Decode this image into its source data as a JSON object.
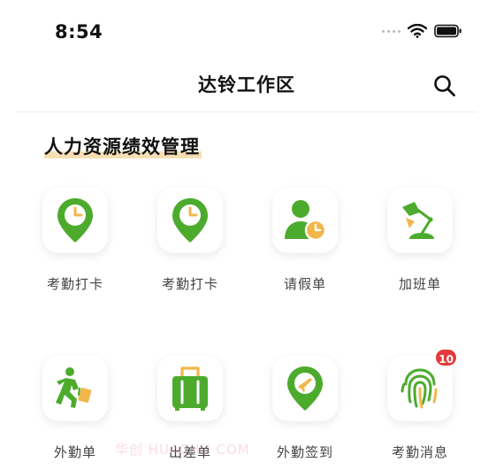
{
  "status_bar": {
    "time": "8:54"
  },
  "nav": {
    "title": "达铃工作区"
  },
  "section": {
    "title": "人力资源绩效管理"
  },
  "tiles": [
    {
      "label": "考勤打卡"
    },
    {
      "label": "考勤打卡"
    },
    {
      "label": "请假单"
    },
    {
      "label": "加班单"
    },
    {
      "label": "外勤单"
    },
    {
      "label": "出差单"
    },
    {
      "label": "外勤签到"
    },
    {
      "label": "考勤消息",
      "badge": "10"
    }
  ],
  "watermark": "华创 HUACHU COM",
  "colors": {
    "accent_green": "#4cab2c",
    "accent_orange": "#f3b64b",
    "underline": "#f7dfb3",
    "badge_red": "#e23a3a"
  }
}
